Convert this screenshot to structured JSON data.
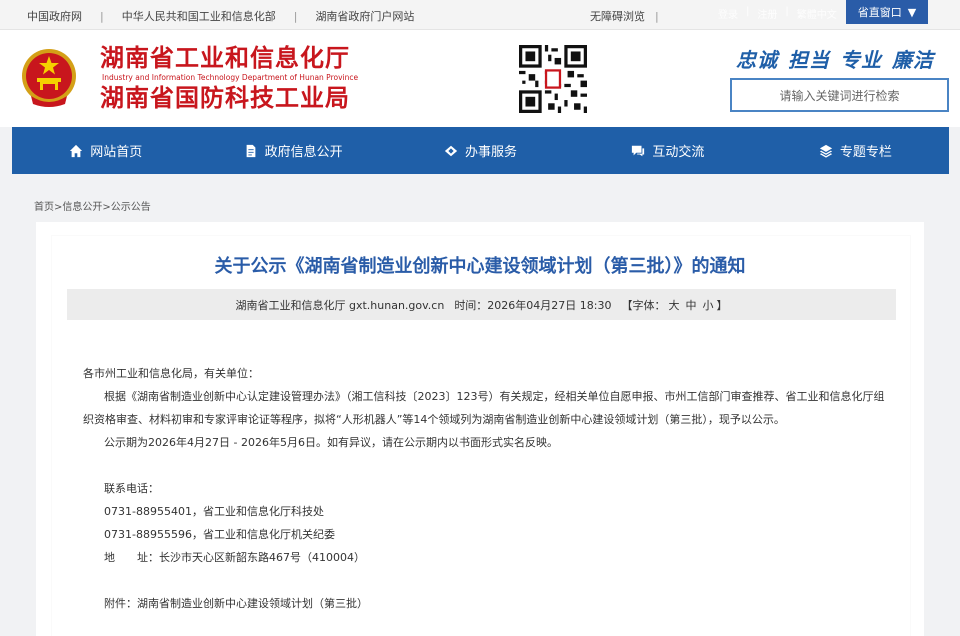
{
  "topbar": {
    "links": [
      "中国政府网",
      "中华人民共和国工业和信息化部",
      "湖南省政府门户网站"
    ],
    "accessibility": "无障碍浏览",
    "login": "登录",
    "register": "注册",
    "traditional": "繁體中文",
    "province_window": "省直窗口",
    "province_window_arrow": "▼"
  },
  "header": {
    "title_line1": "湖南省工业和信息化厅",
    "title_en": "Industry and Information Technology Department of Hunan Province",
    "title_line2": "湖南省国防科技工业局",
    "slogan": [
      "忠诚",
      "担当",
      "专业",
      "廉洁"
    ],
    "search_placeholder": "请输入关键词进行检索"
  },
  "nav": {
    "items": [
      {
        "label": "网站首页",
        "icon": "home-icon"
      },
      {
        "label": "政府信息公开",
        "icon": "document-icon"
      },
      {
        "label": "办事服务",
        "icon": "handshake-icon"
      },
      {
        "label": "互动交流",
        "icon": "chat-icon"
      },
      {
        "label": "专题专栏",
        "icon": "layers-icon"
      }
    ]
  },
  "breadcrumb": "首页>信息公开>公示公告",
  "article": {
    "title": "关于公示《湖南省制造业创新中心建设领域计划（第三批）》的通知",
    "source": "湖南省工业和信息化厅 gxt.hunan.gov.cn",
    "time": "时间：2026年04月27日 18:30",
    "font_size_label": "【字体：",
    "font_large": "大",
    "font_medium": "中",
    "font_small": "小",
    "font_close": "】",
    "salutation": "各市州工业和信息化局，有关单位：",
    "para1": "根据《湖南省制造业创新中心认定建设管理办法》（湘工信科技〔2023〕123号）有关规定，经相关单位自愿申报、市州工信部门审查推荐、省工业和信息化厅组织资格审查、材料初审和专家评审论证等程序，拟将“人形机器人”等14个领域列为湖南省制造业创新中心建设领域计划（第三批），现予以公示。",
    "para2": "公示期为2026年4月27日 - 2026年5月6日。如有异议，请在公示期内以书面形式实名反映。",
    "contact_label": "联系电话：",
    "phone1": "0731-88955401，省工业和信息化厅科技处",
    "phone2": "0731-88955596，省工业和信息化厅机关纪委",
    "address": "地　　址：长沙市天心区新韶东路467号（410004）",
    "attachment": "附件：湖南省制造业创新中心建设领域计划（第三批）"
  },
  "colors": {
    "brand_red": "#c8161d",
    "brand_blue": "#1f5fa8",
    "title_blue": "#2a5ca8"
  }
}
